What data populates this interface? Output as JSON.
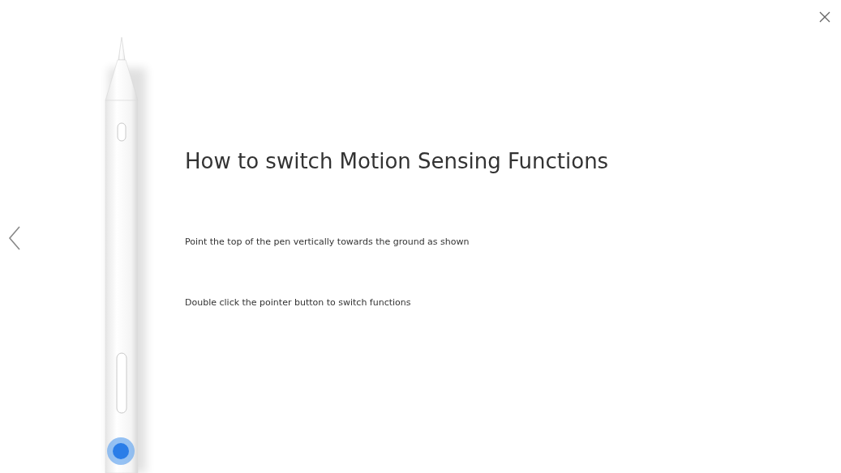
{
  "title": "How to switch Motion Sensing Functions",
  "steps": [
    {
      "text": "Point the top of the pen vertically towards the ground as shown"
    },
    {
      "text": "Double click the pointer button to switch functions"
    }
  ]
}
